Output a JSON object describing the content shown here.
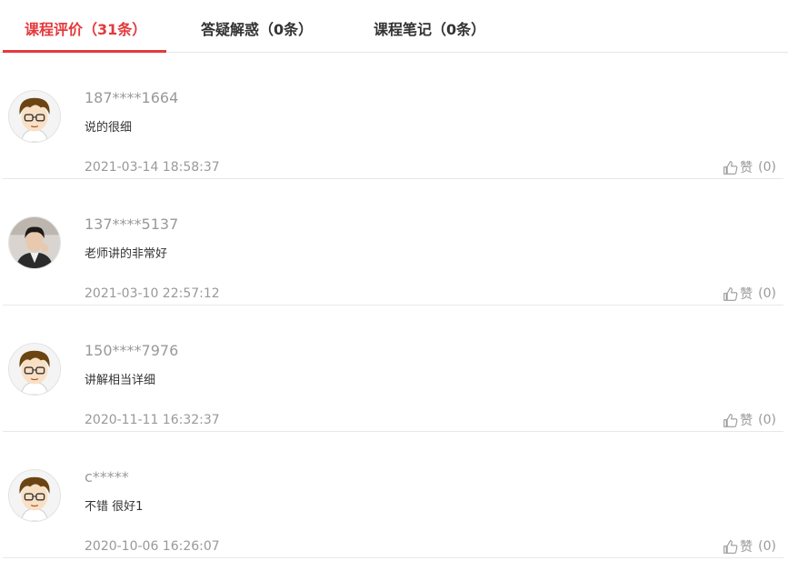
{
  "tabs": [
    {
      "label": "课程评价（31条）",
      "active": true
    },
    {
      "label": "答疑解惑（0条）",
      "active": false
    },
    {
      "label": "课程笔记（0条）",
      "active": false
    }
  ],
  "accent_color": "#e4393c",
  "like_label": "赞",
  "comments": [
    {
      "user": "187****1664",
      "content": "说的很细",
      "time": "2021-03-14 18:58:37",
      "likes": "(0)",
      "avatar": "cartoon-boy-glasses"
    },
    {
      "user": "137****5137",
      "content": "老师讲的非常好",
      "time": "2021-03-10 22:57:12",
      "likes": "(0)",
      "avatar": "photo-portrait"
    },
    {
      "user": "150****7976",
      "content": "讲解相当详细",
      "time": "2020-11-11 16:32:37",
      "likes": "(0)",
      "avatar": "cartoon-boy-glasses"
    },
    {
      "user": "c*****",
      "content": "不错 很好1",
      "time": "2020-10-06 16:26:07",
      "likes": "(0)",
      "avatar": "cartoon-boy-glasses"
    }
  ]
}
